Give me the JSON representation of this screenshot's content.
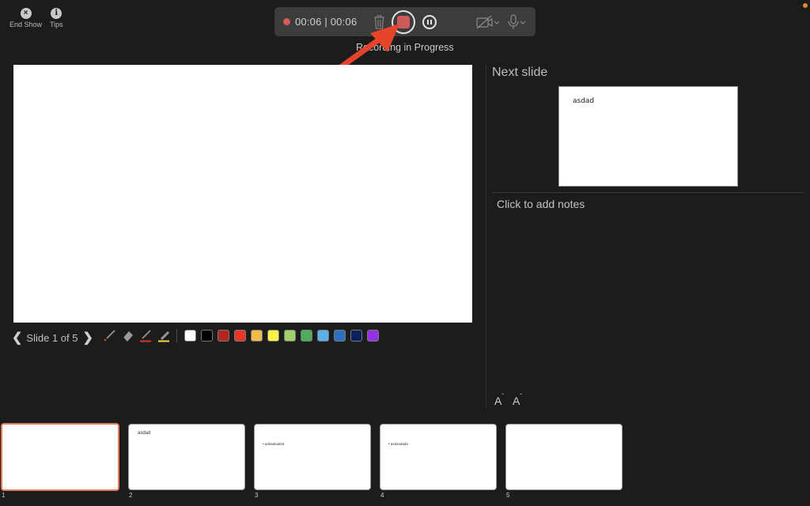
{
  "top_left": {
    "end_show": {
      "icon": "close-icon",
      "glyph": "×",
      "label": "End Show"
    },
    "tips": {
      "icon": "info-icon",
      "glyph": "i",
      "label": "Tips"
    }
  },
  "recording": {
    "elapsed": "00:06",
    "total": "00:06",
    "time_display": "00:06 | 00:06",
    "status_label": "Recording in Progress",
    "accent_color": "#cd5a5c"
  },
  "presenter": {
    "slide_counter": "Slide 1 of 5",
    "prev_glyph": "❮",
    "next_glyph": "❯",
    "ink_tools": [
      "laser-pointer",
      "eraser",
      "pen",
      "highlighter"
    ],
    "colors": [
      "#ffffff",
      "#000000",
      "#b3261e",
      "#e8372a",
      "#f0be48",
      "#fdf347",
      "#a0d06a",
      "#4cae5a",
      "#5ab0ea",
      "#2d6fc0",
      "#0c205e",
      "#9330e8"
    ]
  },
  "next_slide": {
    "title": "Next slide",
    "text": "asdad"
  },
  "notes": {
    "placeholder": "Click to add notes",
    "font_increase": "A",
    "font_decrease": "A"
  },
  "thumbnails": [
    {
      "number": "1",
      "title": "",
      "bullet": "",
      "selected": true
    },
    {
      "number": "2",
      "title": "asdad",
      "bullet": "",
      "selected": false
    },
    {
      "number": "3",
      "title": "",
      "bullet": "• adsadsadsd",
      "selected": false
    },
    {
      "number": "4",
      "title": "",
      "bullet": "• asdasdada",
      "selected": false
    },
    {
      "number": "5",
      "title": "",
      "bullet": "",
      "selected": false
    }
  ]
}
